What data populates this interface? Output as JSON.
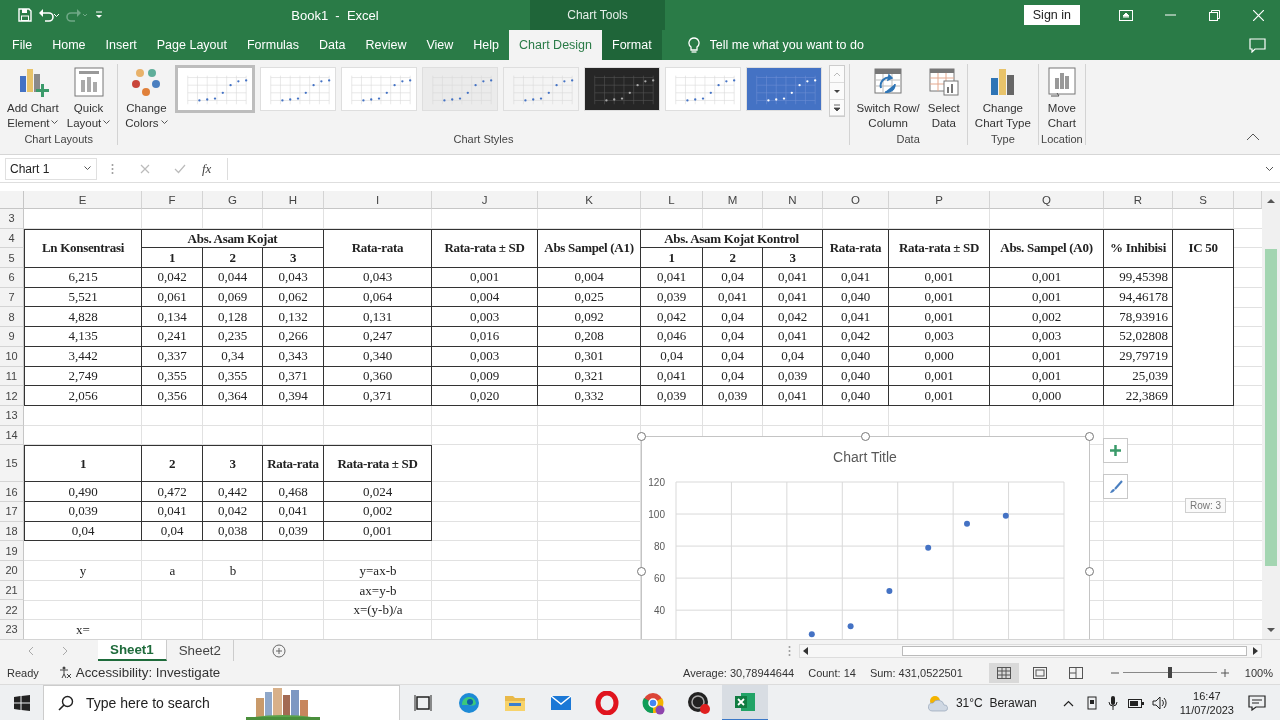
{
  "title_bar": {
    "title": "Book1  -  Excel",
    "context": "Chart Tools",
    "sign_in": "Sign in"
  },
  "tabs": [
    {
      "label": "File",
      "selected": false,
      "contextual": false
    },
    {
      "label": "Home",
      "selected": false,
      "contextual": false
    },
    {
      "label": "Insert",
      "selected": false,
      "contextual": false
    },
    {
      "label": "Page Layout",
      "selected": false,
      "contextual": false
    },
    {
      "label": "Formulas",
      "selected": false,
      "contextual": false
    },
    {
      "label": "Data",
      "selected": false,
      "contextual": false
    },
    {
      "label": "Review",
      "selected": false,
      "contextual": false
    },
    {
      "label": "View",
      "selected": false,
      "contextual": false
    },
    {
      "label": "Help",
      "selected": false,
      "contextual": false
    },
    {
      "label": "Chart Design",
      "selected": true,
      "contextual": true
    },
    {
      "label": "Format",
      "selected": false,
      "contextual": true
    }
  ],
  "tell_me": {
    "placeholder": "Tell me what you want to do"
  },
  "ribbon": [
    {
      "label": "Chart Layouts",
      "buttons": [
        {
          "kind": "add-chart",
          "lines": [
            "Add Chart",
            "Element"
          ],
          "dropdown": true
        },
        {
          "kind": "quick-layout",
          "lines": [
            "Quick",
            "Layout"
          ],
          "dropdown": true
        }
      ]
    },
    {
      "label": "Chart Styles",
      "buttons": [
        {
          "kind": "change-colors",
          "lines": [
            "Change",
            "Colors"
          ],
          "dropdown": true
        }
      ],
      "gallery": [
        {
          "color": "#ffffff",
          "selected": true
        },
        {
          "color": "#ffffff",
          "selected": false
        },
        {
          "color": "#ffffff",
          "selected": false
        },
        {
          "color": "#ebebeb",
          "selected": false
        },
        {
          "color": "#f4f4f4",
          "selected": false
        },
        {
          "color": "#262626",
          "selected": false
        },
        {
          "color": "#ffffff",
          "selected": false
        },
        {
          "color": "#4472c4",
          "selected": false
        }
      ]
    },
    {
      "label": "Data",
      "buttons": [
        {
          "kind": "switch-row-column",
          "lines": [
            "Switch Row/",
            "Column"
          ],
          "dropdown": false
        },
        {
          "kind": "select-data",
          "lines": [
            "Select",
            "Data"
          ],
          "dropdown": false
        }
      ]
    },
    {
      "label": "Type",
      "buttons": [
        {
          "kind": "change-chart-type",
          "lines": [
            "Change",
            "Chart Type"
          ],
          "dropdown": false
        }
      ]
    },
    {
      "label": "Location",
      "buttons": [
        {
          "kind": "move-chart",
          "lines": [
            "Move",
            "Chart"
          ],
          "dropdown": false
        }
      ]
    }
  ],
  "formula_bar": {
    "name_box": "Chart 1",
    "function_button": "fx"
  },
  "sheet": {
    "columns": [
      "E",
      "F",
      "G",
      "H",
      "I",
      "J",
      "K",
      "L",
      "M",
      "N",
      "O",
      "P",
      "Q",
      "R",
      "S"
    ],
    "rows": [
      "3",
      "4",
      "5",
      "6",
      "7",
      "8",
      "9",
      "10",
      "11",
      "12",
      "13",
      "14",
      "15",
      "16",
      "17",
      "18",
      "19",
      "20",
      "21",
      "22",
      "23"
    ],
    "table_1": {
      "header": [
        {
          "label": "Ln Konsentrasi"
        },
        {
          "label": "Abs. Asam Kojat",
          "sub": [
            "1",
            "2",
            "3"
          ]
        },
        {
          "label": "Rata-rata"
        },
        {
          "label": "Rata-rata ± SD"
        },
        {
          "label": "Abs Sampel (A1)"
        },
        {
          "label": "Abs. Asam Kojat Kontrol",
          "sub": [
            "1",
            "2",
            "3"
          ]
        },
        {
          "label": "Rata-rata"
        },
        {
          "label": "Rata-rata ± SD"
        },
        {
          "label": "Abs. Sampel (A0)"
        },
        {
          "label": "% Inhibisi"
        },
        {
          "label": "IC 50"
        }
      ],
      "rows": [
        [
          "6,215",
          "0,042",
          "0,044",
          "0,043",
          "0,043",
          "0,001",
          "0,004",
          "0,041",
          "0,04",
          "0,041",
          "0,041",
          "0,001",
          "0,001",
          "99,45398"
        ],
        [
          "5,521",
          "0,061",
          "0,069",
          "0,062",
          "0,064",
          "0,004",
          "0,025",
          "0,039",
          "0,041",
          "0,041",
          "0,040",
          "0,001",
          "0,001",
          "94,46178"
        ],
        [
          "4,828",
          "0,134",
          "0,128",
          "0,132",
          "0,131",
          "0,003",
          "0,092",
          "0,042",
          "0,04",
          "0,042",
          "0,041",
          "0,001",
          "0,002",
          "78,93916"
        ],
        [
          "4,135",
          "0,241",
          "0,235",
          "0,266",
          "0,247",
          "0,016",
          "0,208",
          "0,046",
          "0,04",
          "0,041",
          "0,042",
          "0,003",
          "0,003",
          "52,02808"
        ],
        [
          "3,442",
          "0,337",
          "0,34",
          "0,343",
          "0,340",
          "0,003",
          "0,301",
          "0,04",
          "0,04",
          "0,04",
          "0,040",
          "0,000",
          "0,001",
          "29,79719"
        ],
        [
          "2,749",
          "0,355",
          "0,355",
          "0,371",
          "0,360",
          "0,009",
          "0,321",
          "0,041",
          "0,04",
          "0,039",
          "0,040",
          "0,001",
          "0,001",
          "25,039"
        ],
        [
          "2,056",
          "0,356",
          "0,364",
          "0,394",
          "0,371",
          "0,020",
          "0,332",
          "0,039",
          "0,039",
          "0,041",
          "0,040",
          "0,001",
          "0,000",
          "22,3869"
        ]
      ]
    },
    "table_2": {
      "header": [
        {
          "label": "1"
        },
        {
          "label": "2"
        },
        {
          "label": "3"
        },
        {
          "label": "Rata-rata"
        },
        {
          "label": "Rata-rata ± SD"
        }
      ],
      "rows": [
        [
          "0,490",
          "0,472",
          "0,442",
          "0,468",
          "0,024"
        ],
        [
          "0,039",
          "0,041",
          "0,042",
          "0,041",
          "0,002"
        ],
        [
          "0,04",
          "0,04",
          "0,038",
          "0,039",
          "0,001"
        ]
      ]
    },
    "solver": {
      "variables": [
        "y",
        "a",
        "b"
      ],
      "equations": [
        "y=ax-b",
        "ax=y-b",
        "x=(y-b)/a"
      ],
      "result_label": "x="
    },
    "chart": {
      "chart_data": {
        "type": "scatter",
        "title": "Chart Title",
        "categories": [
          null,
          null,
          null,
          null,
          null,
          null,
          null,
          null,
          null,
          null
        ],
        "grid": true,
        "series": [
          {
            "color": "#4472c4",
            "values": [
              null,
              null,
              null,
              25,
              30,
              52,
              79,
              94,
              99,
              null
            ]
          }
        ],
        "ylim": [
          22,
          120
        ],
        "yticks": [
          40,
          60,
          80,
          100,
          120
        ]
      }
    },
    "tooltip": "Row: 3"
  },
  "sheet_tabs": [
    {
      "label": "Sheet1",
      "selected": true
    },
    {
      "label": "Sheet2",
      "selected": false
    }
  ],
  "status_bar": {
    "mode": "Ready",
    "accessibility": "Accessibility: Investigate",
    "average": "Average: 30,78944644",
    "count": "Count: 14",
    "sum": "Sum: 431,0522501",
    "views": [
      {
        "kind": "normal",
        "selected": true
      },
      {
        "kind": "page-layout",
        "selected": false
      },
      {
        "kind": "page-break",
        "selected": false
      }
    ],
    "zoom": {
      "level": 0.5,
      "reading": "100%"
    }
  },
  "taskbar": {
    "search_placeholder": "Type here to search",
    "apps": [
      {
        "kind": "task-view",
        "active": false
      },
      {
        "kind": "edge",
        "active": false
      },
      {
        "kind": "explorer",
        "active": false
      },
      {
        "kind": "mail",
        "active": false
      },
      {
        "kind": "opera",
        "active": false
      },
      {
        "kind": "chrome",
        "active": false
      },
      {
        "kind": "obs",
        "active": false
      },
      {
        "kind": "excel",
        "active": true
      }
    ],
    "weather": "31°C  Berawan",
    "time": "16:47",
    "date": "11/07/2023"
  }
}
